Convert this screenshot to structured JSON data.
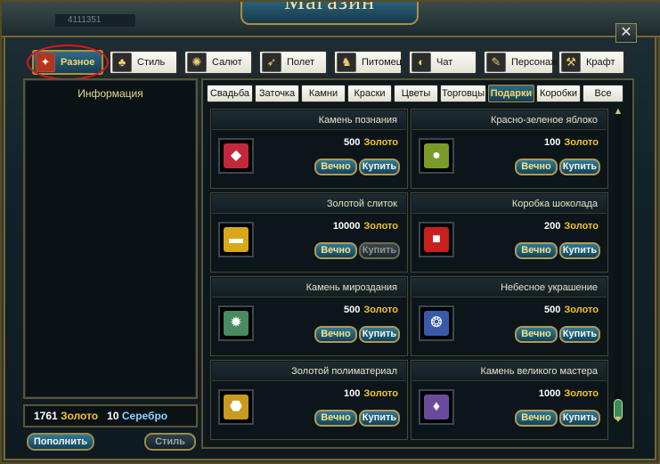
{
  "window": {
    "title": "Магазин",
    "user_tag": "4111351",
    "close_label": "✕"
  },
  "categories": [
    {
      "label": "Разное",
      "icon": "gift-bag-icon",
      "glyph": "✦",
      "active": true
    },
    {
      "label": "Стиль",
      "icon": "costume-icon",
      "glyph": "♣"
    },
    {
      "label": "Салют",
      "icon": "firework-icon",
      "glyph": "✺"
    },
    {
      "label": "Полет",
      "icon": "wing-icon",
      "glyph": "➶"
    },
    {
      "label": "Питомец",
      "icon": "pet-icon",
      "glyph": "♞"
    },
    {
      "label": "Чат",
      "icon": "chat-icon",
      "glyph": "◐"
    },
    {
      "label": "Персонаж",
      "icon": "character-icon",
      "glyph": "✎"
    },
    {
      "label": "Крафт",
      "icon": "craft-icon",
      "glyph": "⚒"
    }
  ],
  "info": {
    "title": "Информация"
  },
  "currency": {
    "gold_amount": "1761",
    "gold_label": "Золото",
    "silver_amount": "10",
    "silver_label": "Серебро"
  },
  "buttons": {
    "topup": "Пополнить",
    "style": "Стиль"
  },
  "subtabs": [
    {
      "label": "Свадьба"
    },
    {
      "label": "Заточка"
    },
    {
      "label": "Камни"
    },
    {
      "label": "Краски"
    },
    {
      "label": "Цветы"
    },
    {
      "label": "Торговцы"
    },
    {
      "label": "Подарки",
      "active": true
    },
    {
      "label": "Коробки"
    },
    {
      "label": "Все"
    }
  ],
  "items": [
    {
      "name": "Камень познания",
      "price": "500",
      "currency": "Золото",
      "forever": "Вечно",
      "buy": "Купить",
      "icon": "red-gem-icon",
      "color": "#c2283c",
      "glyph": "◆"
    },
    {
      "name": "Красно-зеленое яблоко",
      "price": "100",
      "currency": "Золото",
      "forever": "Вечно",
      "buy": "Купить",
      "icon": "apple-icon",
      "color": "#7a9a2a",
      "glyph": "●"
    },
    {
      "name": "Золотой слиток",
      "price": "10000",
      "currency": "Золото",
      "forever": "Вечно",
      "buy": "Купить",
      "buy_disabled": true,
      "icon": "gold-ingot-icon",
      "color": "#d8a818",
      "glyph": "▬"
    },
    {
      "name": "Коробка шоколада",
      "price": "200",
      "currency": "Золото",
      "forever": "Вечно",
      "buy": "Купить",
      "icon": "gift-box-icon",
      "color": "#c8201c",
      "glyph": "■"
    },
    {
      "name": "Камень мироздания",
      "price": "500",
      "currency": "Золото",
      "forever": "Вечно",
      "buy": "Купить",
      "icon": "green-crystal-icon",
      "color": "#4a8a62",
      "glyph": "✹"
    },
    {
      "name": "Небесное украшение",
      "price": "500",
      "currency": "Золото",
      "forever": "Вечно",
      "buy": "Купить",
      "icon": "scroll-ornament-icon",
      "color": "#3a5aa8",
      "glyph": "❂"
    },
    {
      "name": "Золотой полиматериал",
      "price": "100",
      "currency": "Золото",
      "forever": "Вечно",
      "buy": "Купить",
      "icon": "gold-nugget-icon",
      "color": "#c89a20",
      "glyph": "⬣"
    },
    {
      "name": "Камень великого мастера",
      "price": "1000",
      "currency": "Золото",
      "forever": "Вечно",
      "buy": "Купить",
      "icon": "purple-crystal-icon",
      "color": "#6a4a9a",
      "glyph": "♦"
    }
  ],
  "scrollbar": {
    "up": "▲",
    "down": "▼"
  }
}
